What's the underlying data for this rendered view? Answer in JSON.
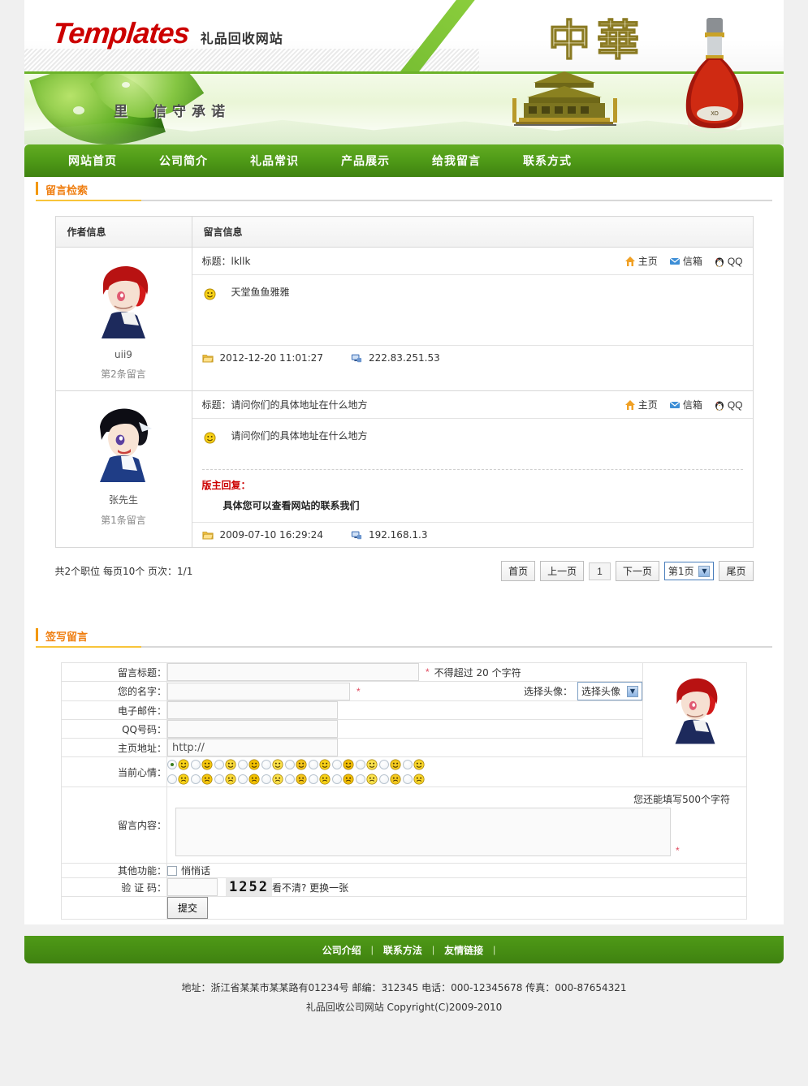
{
  "header": {
    "logo_main": "Templates",
    "logo_sub": "礼品回收网站",
    "slogan": "里　信守承诺",
    "art_text": "中華"
  },
  "nav": {
    "items": [
      {
        "label": "网站首页"
      },
      {
        "label": "公司简介"
      },
      {
        "label": "礼品常识"
      },
      {
        "label": "产品展示"
      },
      {
        "label": "给我留言"
      },
      {
        "label": "联系方式"
      }
    ]
  },
  "search_section": {
    "title": "留言检索"
  },
  "guestbook": {
    "columns": {
      "author": "作者信息",
      "message": "留言信息"
    },
    "link_labels": {
      "home": "主页",
      "mail": "信箱",
      "qq": "QQ"
    },
    "title_prefix": "标题：",
    "posts": [
      {
        "author": "uii9",
        "order": "第2条留言",
        "avatar": "red-hair-avatar",
        "title": "lkllk",
        "body": "天堂鱼鱼雅雅",
        "reply_label": "",
        "reply_text": "",
        "date": "2012-12-20 11:01:27",
        "ip": "222.83.251.53"
      },
      {
        "author": "张先生",
        "order": "第1条留言",
        "avatar": "black-hair-avatar",
        "title": "请问你们的具体地址在什么地方",
        "body": "请问你们的具体地址在什么地方",
        "reply_label": "版主回复：",
        "reply_text": "具体您可以查看网站的联系我们",
        "date": "2009-07-10 16:29:24",
        "ip": "192.168.1.3"
      }
    ]
  },
  "pager": {
    "info": "共2个职位 每页10个 页次：1/1",
    "first": "首页",
    "prev": "上一页",
    "current_num": "1",
    "next": "下一页",
    "select_value": "第1页",
    "last": "尾页"
  },
  "form_section": {
    "title": "签写留言"
  },
  "form": {
    "fields": {
      "title_label": "留言标题：",
      "title_value": "",
      "title_required": "*",
      "title_hint": "不得超过 20 个字符",
      "name_label": "您的名字：",
      "name_value": "",
      "name_required": "*",
      "avatar_select_label": "选择头像：",
      "avatar_select_value": "选择头像",
      "email_label": "电子邮件：",
      "email_value": "",
      "qq_label": "QQ号码：",
      "qq_value": "",
      "homepage_label": "主页地址：",
      "homepage_value": "http://",
      "mood_label": "当前心情：",
      "content_label": "留言内容：",
      "content_value": "",
      "content_hint": "您还能填写500个字符",
      "content_required": "*",
      "other_label": "其他功能：",
      "other_checkbox_label": "悄悄话",
      "captcha_label": "验 证 码：",
      "captcha_value": "",
      "captcha_code": "1252",
      "captcha_refresh": "看不清? 更换一张",
      "submit_label": "提交"
    },
    "mood_rows": [
      [
        "smile",
        "nerd",
        "cool-hat",
        "wink",
        "grin",
        "sunglasses",
        "tongue",
        "surprise",
        "dizzy",
        "sad",
        "laugh"
      ],
      [
        "confused",
        "worried",
        "smirk",
        "silly",
        "neutral",
        "big-grin",
        "crazy",
        "yum",
        "happy",
        "wink2",
        "shy"
      ]
    ],
    "mood_selected": 0
  },
  "footer": {
    "links": [
      "公司介绍",
      "联系方法",
      "友情链接"
    ],
    "separator": "|",
    "address_line": "地址：浙江省某某市某某路有01234号 邮编：312345 电话：000-12345678 传真：000-87654321",
    "copyright": "礼品回收公司网站 Copyright(C)2009-2010"
  }
}
